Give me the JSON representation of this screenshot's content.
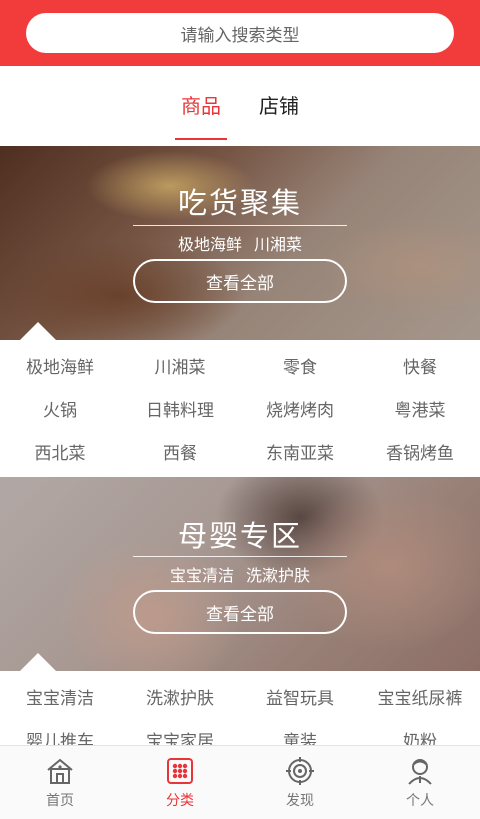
{
  "search": {
    "placeholder": "请输入搜索类型"
  },
  "tabs": [
    {
      "label": "商品",
      "active": true
    },
    {
      "label": "店铺",
      "active": false
    }
  ],
  "sections": [
    {
      "title": "吃货聚集",
      "tags": [
        "极地海鲜",
        "川湘菜"
      ],
      "view_all": "查看全部",
      "items": [
        "极地海鲜",
        "川湘菜",
        "零食",
        "快餐",
        "火锅",
        "日韩料理",
        "烧烤烤肉",
        "粤港菜",
        "西北菜",
        "西餐",
        "东南亚菜",
        "香锅烤鱼"
      ]
    },
    {
      "title": "母婴专区",
      "tags": [
        "宝宝清洁",
        "洗漱护肤"
      ],
      "view_all": "查看全部",
      "items": [
        "宝宝清洁",
        "洗漱护肤",
        "益智玩具",
        "宝宝纸尿裤",
        "婴儿推车",
        "宝宝家居",
        "童装",
        "奶粉"
      ]
    }
  ],
  "bottom_nav": [
    {
      "label": "首页",
      "icon": "home-icon",
      "active": false
    },
    {
      "label": "分类",
      "icon": "category-grid-icon",
      "active": true
    },
    {
      "label": "发现",
      "icon": "discover-target-icon",
      "active": false
    },
    {
      "label": "个人",
      "icon": "user-icon",
      "active": false
    }
  ],
  "colors": {
    "accent": "#f23b3b",
    "active_text": "#e9343a",
    "gray_text": "#666666"
  }
}
